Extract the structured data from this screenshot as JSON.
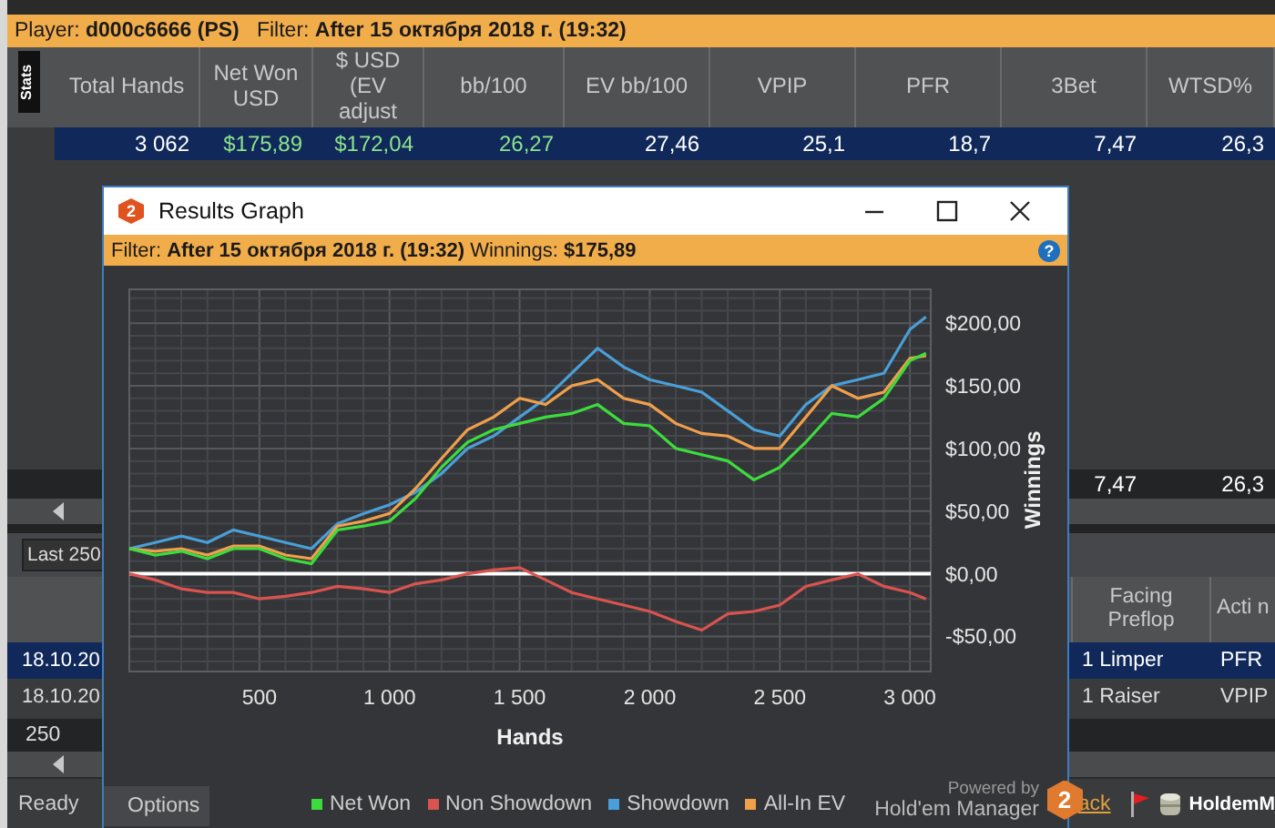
{
  "app": {
    "filter_bar": {
      "text": "Player: **d000c6666 (PS)**   Filter: **After 15 октября 2018 г. (19:32)**"
    },
    "stats_tab": {
      "label": "Stats",
      "selected": true
    },
    "stats_table": {
      "columns": [
        "Total Hands",
        "Net Won USD",
        "$ USD (EV adjust",
        "bb/100",
        "EV bb/100",
        "VPIP",
        "PFR",
        "3Bet",
        "WTSD%"
      ],
      "rows": [
        {
          "selected": true,
          "cells": [
            {
              "text": "3 062",
              "kind": "plain"
            },
            {
              "text": "$175,89",
              "kind": "positive"
            },
            {
              "text": "$172,04",
              "kind": "positive"
            },
            {
              "text": "26,27",
              "kind": "positive"
            },
            {
              "text": "27,46",
              "kind": "plain"
            },
            {
              "text": "25,1",
              "kind": "plain"
            },
            {
              "text": "18,7",
              "kind": "plain"
            },
            {
              "text": "7,47",
              "kind": "plain"
            },
            {
              "text": "26,3",
              "kind": "plain"
            }
          ]
        }
      ],
      "totals_row": {
        "visible_cells": [
          "7,47",
          "26,3"
        ]
      }
    },
    "hands_panel": {
      "range_dropdown": {
        "value": "Last 250"
      },
      "columns": [
        "Facing Preflop",
        "Acti n"
      ],
      "rows": [
        {
          "selected": true,
          "date": "18.10.20",
          "facing_preflop": "1 Limper",
          "action": "PFR"
        },
        {
          "selected": false,
          "date": "18.10.20",
          "facing_preflop": "1 Raiser",
          "action": "VPIP"
        }
      ],
      "totals_row": {
        "count": "250"
      }
    },
    "status_bar": {
      "status": "Ready",
      "link": "ack",
      "app_name": "HoldemM"
    }
  },
  "graph_window": {
    "logo_text": "2",
    "title": "Results Graph",
    "filter_bar": {
      "text": "Filter: **After 15 октября 2018 г. (19:32)** Winnings: **$175,89**",
      "help": "?"
    },
    "chart_data": {
      "type": "line",
      "grid": true,
      "xlabel": "Hands",
      "ylabel": "Winnings",
      "x": [
        0,
        100,
        200,
        300,
        400,
        500,
        600,
        700,
        800,
        900,
        1000,
        1100,
        1200,
        1300,
        1400,
        1500,
        1600,
        1700,
        1800,
        1900,
        2000,
        2100,
        2200,
        2300,
        2400,
        2500,
        2600,
        2700,
        2800,
        2900,
        3000,
        3062
      ],
      "series": [
        {
          "name": "Net Won",
          "color": "#3ddc3d",
          "values": [
            20,
            15,
            18,
            12,
            20,
            20,
            12,
            8,
            35,
            38,
            42,
            60,
            85,
            105,
            115,
            120,
            125,
            128,
            135,
            120,
            118,
            100,
            95,
            90,
            75,
            85,
            105,
            128,
            125,
            140,
            170,
            176
          ]
        },
        {
          "name": "Non Showdown",
          "color": "#d9534f",
          "values": [
            0,
            -5,
            -12,
            -15,
            -15,
            -20,
            -18,
            -15,
            -10,
            -12,
            -15,
            -8,
            -5,
            0,
            3,
            5,
            -5,
            -15,
            -20,
            -25,
            -30,
            -38,
            -45,
            -32,
            -30,
            -25,
            -10,
            -5,
            0,
            -10,
            -15,
            -20
          ]
        },
        {
          "name": "Showdown",
          "color": "#4a9fd8",
          "values": [
            20,
            25,
            30,
            25,
            35,
            30,
            25,
            20,
            40,
            48,
            55,
            65,
            80,
            100,
            110,
            125,
            140,
            160,
            180,
            165,
            155,
            150,
            145,
            130,
            115,
            110,
            135,
            150,
            155,
            160,
            195,
            205
          ]
        },
        {
          "name": "All-In EV",
          "color": "#f0a04b",
          "values": [
            20,
            18,
            20,
            15,
            22,
            22,
            15,
            12,
            38,
            42,
            48,
            68,
            92,
            115,
            125,
            140,
            135,
            150,
            155,
            140,
            135,
            120,
            112,
            110,
            100,
            100,
            125,
            150,
            140,
            145,
            172,
            174
          ]
        }
      ],
      "xlim": [
        0,
        3080
      ],
      "ylim": [
        -78,
        227
      ],
      "xticks": [
        {
          "value": 500,
          "label": "500"
        },
        {
          "value": 1000,
          "label": "1 000"
        },
        {
          "value": 1500,
          "label": "1 500"
        },
        {
          "value": 2000,
          "label": "2 000"
        },
        {
          "value": 2500,
          "label": "2 500"
        },
        {
          "value": 3000,
          "label": "3 000"
        }
      ],
      "yticks": [
        {
          "value": 200,
          "label": "$200,00"
        },
        {
          "value": 150,
          "label": "$150,00"
        },
        {
          "value": 100,
          "label": "$100,00"
        },
        {
          "value": 50,
          "label": "$50,00"
        },
        {
          "value": 0,
          "label": "$0,00"
        },
        {
          "value": -50,
          "label": "-$50,00"
        }
      ]
    },
    "options_button": "Options",
    "powered_by": {
      "caption": "Powered by",
      "product": "Hold'em Manager",
      "badge": "2"
    }
  }
}
